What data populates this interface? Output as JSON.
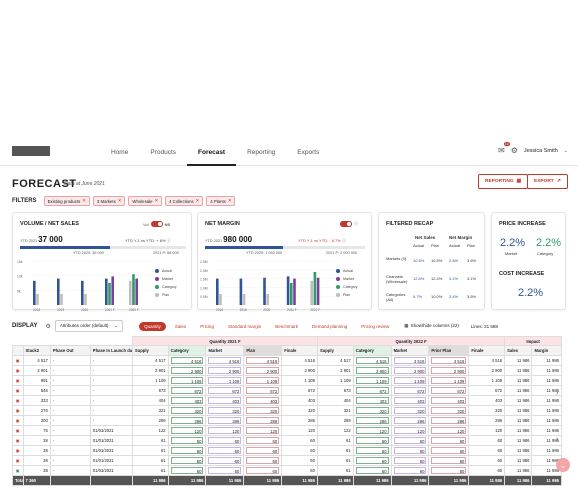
{
  "nav": {
    "items": [
      "Home",
      "Products",
      "Forecast",
      "Reporting",
      "Exports"
    ],
    "active": "Forecast",
    "notif_count": "10",
    "user": "Jessica Smith"
  },
  "header": {
    "title": "FORECAST",
    "subtitle": "Data at June 2021",
    "reporting_label": "REPORTING",
    "export_label": "EXPORT"
  },
  "filters": {
    "label": "FILTERS",
    "chips": [
      "Existing products",
      "3 Markets",
      "Wholesale",
      "4 Collections",
      "4 Plants"
    ]
  },
  "volume_card": {
    "title": "VOLUME / NET SALES",
    "toggle_left": "Vol",
    "toggle_right": "NS",
    "ytd_label": "YTD 2021",
    "ytd_value": "37 000",
    "yoy_text": "YTD Y-1 vs YTD: + 8%",
    "ytd2020": "YTD 2020: 35 000",
    "p_label": "2021 P: 68 000",
    "y_ticks": [
      "15k",
      "10k",
      "5k"
    ]
  },
  "margin_card": {
    "title": "NET MARGIN",
    "ytd_label": "YTD 2021",
    "ytd_value": "980 000",
    "yoy_text": "YTD Y-1 vs YTD: - 6.7%",
    "ytd2020": "YTD 2020: 1 050 000",
    "p_label": "2021 P: 2 000 000",
    "y_ticks": [
      "2.5M",
      "2.0M",
      "1.5M",
      "1.0M",
      "0.5M"
    ]
  },
  "legend": [
    "Actual",
    "Market",
    "Category",
    "Plan"
  ],
  "legend_colors": {
    "Actual": "#2f5597",
    "Market": "#7b3fa0",
    "Category": "#2e9c6a",
    "Plan": "#bdbdbd"
  },
  "recap": {
    "title": "FILTERED RECAP",
    "col1": "Net Sales",
    "col2": "Net Margin",
    "sub": [
      "Actual",
      "Plan",
      "Actual",
      "Plan"
    ],
    "rows": [
      {
        "label": "Markets (3)",
        "vals": [
          "10.5%",
          "10.5%",
          "2.8%",
          "3.6%"
        ]
      },
      {
        "label": "Channels (Wholesale)",
        "vals": [
          "12.8%",
          "12.4%",
          "3.1%",
          "3.1%"
        ]
      },
      {
        "label": "Categories (All)",
        "vals": [
          "9.7%",
          "10.0%",
          "3.4%",
          "3.5%"
        ]
      }
    ]
  },
  "price": {
    "title": "PRICE INCREASE",
    "market": "2.2%",
    "category": "2.2%",
    "market_label": "Market",
    "category_label": "Category",
    "cost_title": "COST INCREASE",
    "cost": "2.2%"
  },
  "display": {
    "label": "DISPLAY",
    "select": "Attributes order (default)",
    "pills": [
      "Quantity",
      "Sales",
      "Pricing",
      "Standard margin",
      "Benchmark",
      "Demand planning",
      "Pricing review"
    ],
    "active_pill": "Quantity",
    "show_hide": "Show/hide columns (22)",
    "lines": "Lines: 21 688"
  },
  "table": {
    "groups": [
      "Quantity 2021 F",
      "Quantity 2022 F",
      "Impact"
    ],
    "headers": [
      "",
      "Stack2",
      "Phase Out",
      "Phase In Launch date",
      "Supply",
      "Category",
      "Market",
      "Plan",
      "Finale",
      "Supply",
      "Category",
      "Market",
      "Prior Plan",
      "Finale",
      "Sales",
      "Margin"
    ],
    "rows": [
      [
        "4 517",
        "-",
        "-",
        "4 517",
        "4 516",
        "4 516",
        "4 516",
        "4 516",
        "4 517",
        "4 516",
        "4 516",
        "4 516",
        "4 516",
        "11 986",
        "11 986"
      ],
      [
        "2 901",
        "-",
        "-",
        "2 901",
        "2 900",
        "2 900",
        "2 900",
        "2 900",
        "2 901",
        "2 900",
        "2 900",
        "2 900",
        "2 900",
        "11 986",
        "11 986"
      ],
      [
        "991",
        "-",
        "-",
        "1 109",
        "1 109",
        "1 109",
        "1 109",
        "1 109",
        "1 109",
        "1 109",
        "1 109",
        "1 109",
        "1 109",
        "11 986",
        "11 986"
      ],
      [
        "545",
        "-",
        "-",
        "673",
        "672",
        "672",
        "672",
        "672",
        "673",
        "672",
        "672",
        "672",
        "672",
        "11 986",
        "11 986"
      ],
      [
        "333",
        "-",
        "-",
        "404",
        "403",
        "403",
        "403",
        "403",
        "404",
        "403",
        "403",
        "403",
        "403",
        "11 986",
        "11 986"
      ],
      [
        "276",
        "-",
        "-",
        "321",
        "320",
        "320",
        "320",
        "320",
        "321",
        "320",
        "320",
        "320",
        "320",
        "11 986",
        "11 986"
      ],
      [
        "200",
        "-",
        "-",
        "289",
        "286",
        "286",
        "286",
        "286",
        "289",
        "286",
        "286",
        "286",
        "286",
        "11 986",
        "11 986"
      ],
      [
        "76",
        "-",
        "01/01/2021",
        "122",
        "120",
        "120",
        "120",
        "120",
        "122",
        "120",
        "120",
        "120",
        "120",
        "11 986",
        "11 986"
      ],
      [
        "38",
        "-",
        "01/01/2021",
        "61",
        "60",
        "60",
        "60",
        "60",
        "61",
        "60",
        "60",
        "60",
        "60",
        "11 986",
        "11 986"
      ],
      [
        "38",
        "-",
        "01/01/2021",
        "61",
        "60",
        "60",
        "60",
        "60",
        "61",
        "60",
        "60",
        "60",
        "60",
        "11 986",
        "11 986"
      ],
      [
        "38",
        "-",
        "01/01/2021",
        "61",
        "60",
        "60",
        "60",
        "60",
        "61",
        "60",
        "60",
        "60",
        "60",
        "11 986",
        "11 986"
      ],
      [
        "38",
        "-",
        "01/01/2021",
        "61",
        "60",
        "60",
        "60",
        "60",
        "61",
        "60",
        "60",
        "60",
        "60",
        "11 986",
        "11 986"
      ]
    ],
    "total": [
      "Total",
      "7 360",
      "",
      "",
      "11 986",
      "11 986",
      "11 986",
      "11 986",
      "11 986",
      "11 986",
      "11 986",
      "11 986",
      "11 986",
      "11 986",
      "11 986",
      "11 986"
    ]
  }
}
